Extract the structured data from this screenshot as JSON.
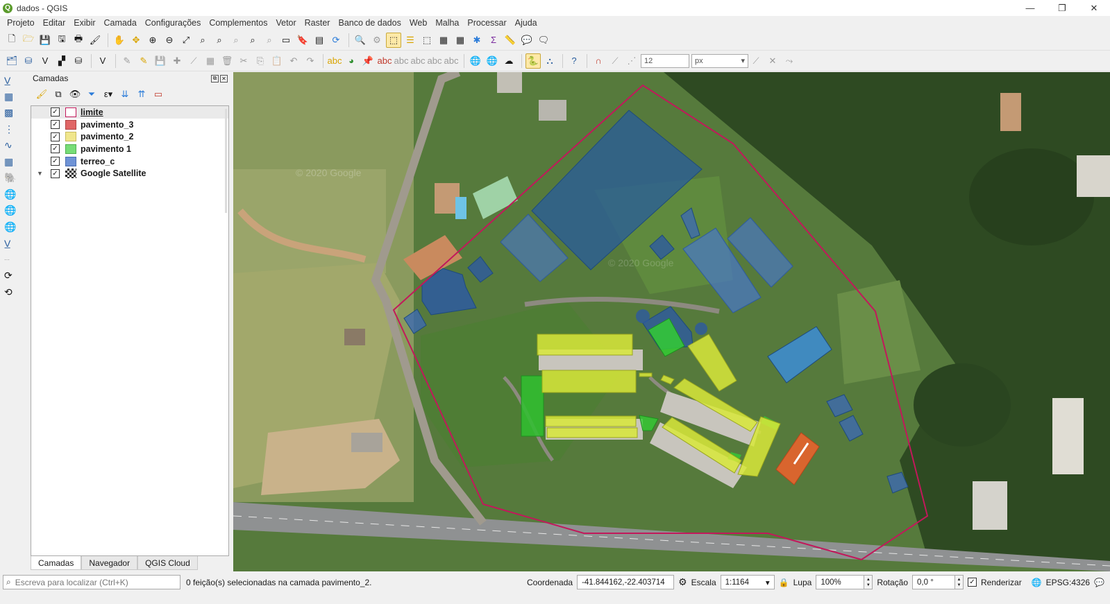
{
  "window": {
    "title": "dados - QGIS",
    "controls": [
      "—",
      "❐",
      "✕"
    ]
  },
  "menu": [
    "Projeto",
    "Editar",
    "Exibir",
    "Camada",
    "Configurações",
    "Complementos",
    "Vetor",
    "Raster",
    "Banco de dados",
    "Web",
    "Malha",
    "Processar",
    "Ajuda"
  ],
  "toolbar2": {
    "snap_tolerance": "12",
    "snap_unit": "px"
  },
  "layers_panel": {
    "title": "Camadas",
    "layers": [
      {
        "name": "limite",
        "checked": true,
        "swatch": "#ffffff",
        "border": "#c2185b",
        "selected": true
      },
      {
        "name": "pavimento_3",
        "checked": true,
        "swatch": "#e06666",
        "border": "#b04545"
      },
      {
        "name": "pavimento_2",
        "checked": true,
        "swatch": "#f0e68c",
        "border": "#c9bd60"
      },
      {
        "name": "pavimento 1",
        "checked": true,
        "swatch": "#77dd77",
        "border": "#4fae4f"
      },
      {
        "name": "terreo_c",
        "checked": true,
        "swatch": "#6f93d6",
        "border": "#4a6eb0"
      },
      {
        "name": "Google Satellite",
        "checked": true,
        "swatch": "raster",
        "expanded": true
      }
    ],
    "tabs": [
      "Camadas",
      "Navegador",
      "QGIS Cloud"
    ]
  },
  "status": {
    "locator_placeholder": "Escreva para localizar (Ctrl+K)",
    "message": "0 feição(s) selecionadas na camada pavimento_2.",
    "coord_label": "Coordenada",
    "coord_value": "-41.844162,-22.403714",
    "scale_label": "Escala",
    "scale_value": "1:1164",
    "magnifier_label": "Lupa",
    "magnifier_value": "100%",
    "rotation_label": "Rotação",
    "rotation_value": "0,0 °",
    "render_label": "Renderizar",
    "crs": "EPSG:4326"
  },
  "map": {
    "watermark": "© 2020 Google"
  },
  "colors": {
    "limite": "#c2185b",
    "terreo": "#4a78c2",
    "pav1": "#33cc33",
    "pav2": "#d8e83a",
    "pav3": "#e8632c"
  }
}
